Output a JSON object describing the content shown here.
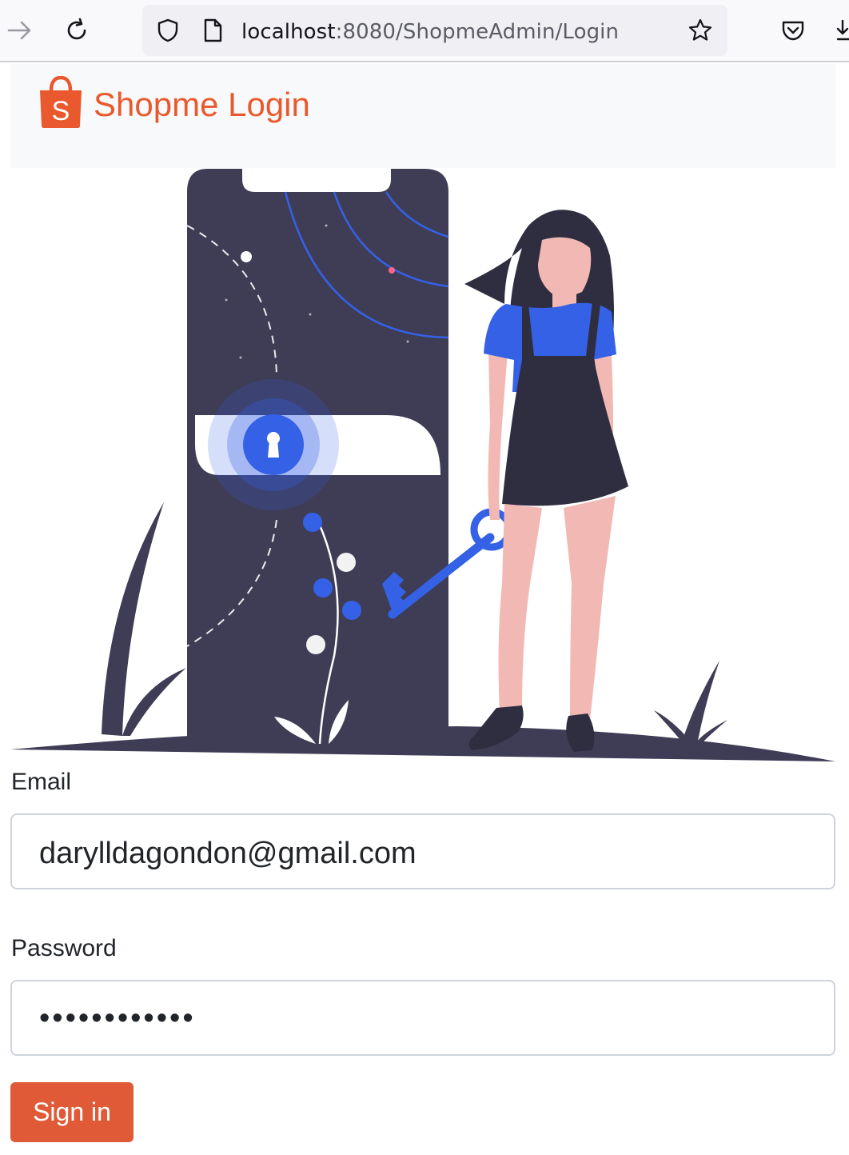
{
  "browser": {
    "url_host": "localhost",
    "url_path": ":8080/ShopmeAdmin/Login",
    "icons": [
      "forward-icon",
      "reload-icon",
      "shield-icon",
      "page-icon",
      "bookmark-star-icon",
      "pocket-icon",
      "download-icon"
    ]
  },
  "header": {
    "brand": "Shopme Login",
    "logo_letter": "S",
    "brand_color": "#e9592d"
  },
  "form": {
    "email_label": "Email",
    "email_value": "darylldagondon@gmail.com",
    "password_label": "Password",
    "password_masked": "••••••••••••",
    "submit_label": "Sign in",
    "submit_color": "#e05a37"
  },
  "illustration": {
    "accent": "#3461e6",
    "dark": "#3f3d56",
    "skin": "#f2b9b4"
  }
}
